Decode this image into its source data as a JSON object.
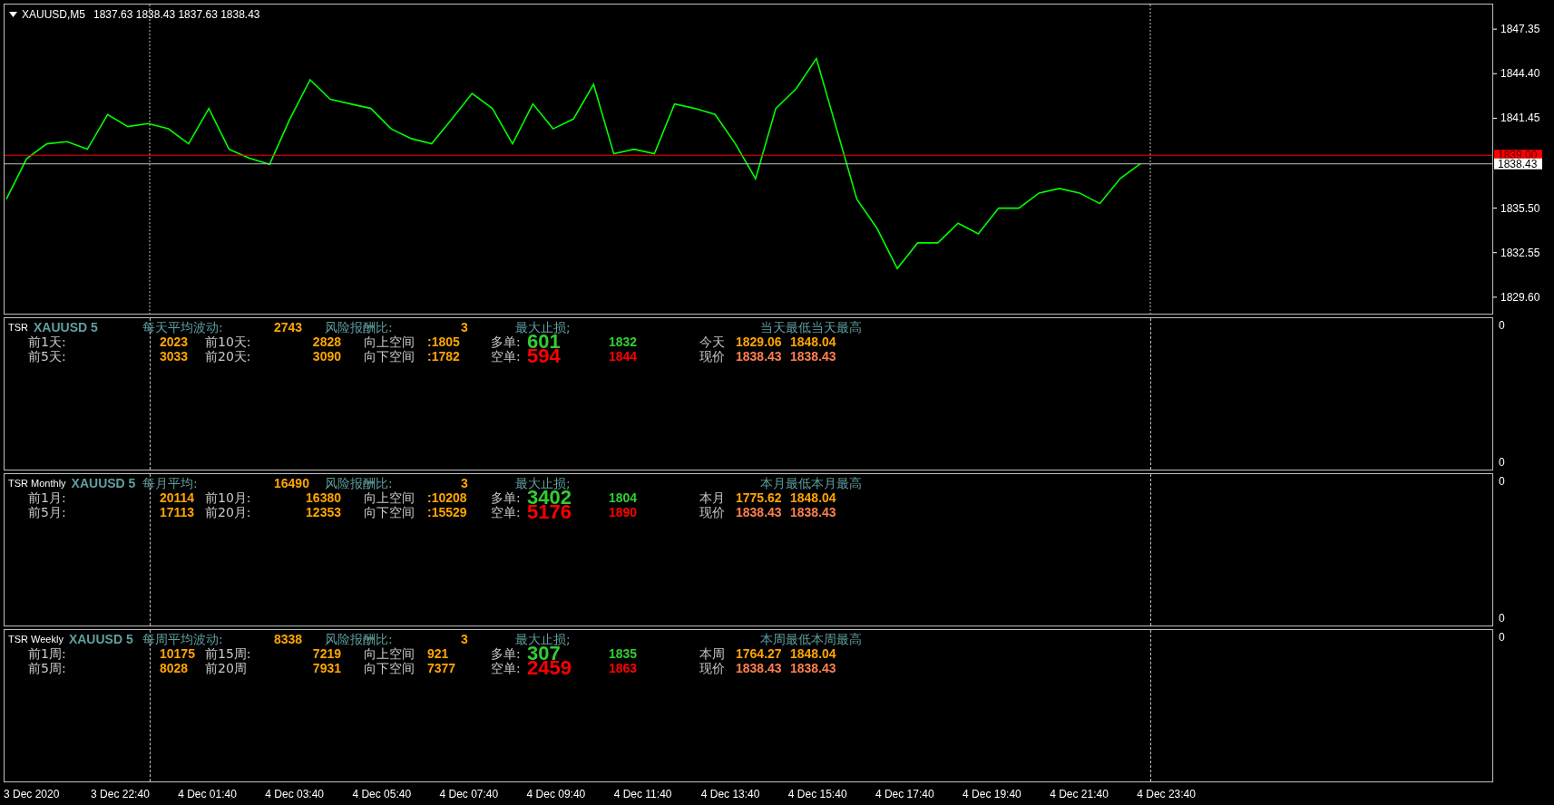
{
  "chart": {
    "symbol": "XAUUSD,M5",
    "ohlc": "1837.63 1838.43 1837.63 1838.43",
    "chart_data": {
      "type": "line",
      "ylim": [
        1828.45,
        1849.04
      ],
      "yticks": [
        {
          "value": 1847.35,
          "label": "1847.35"
        },
        {
          "value": 1844.4,
          "label": "1844.40"
        },
        {
          "value": 1841.45,
          "label": "1841.45"
        },
        {
          "value": 1835.5,
          "label": "1835.50"
        },
        {
          "value": 1832.55,
          "label": "1832.55"
        },
        {
          "value": 1829.6,
          "label": "1829.60"
        }
      ],
      "series": [
        {
          "color": "#00ff00",
          "values": [
            1836.1,
            1838.77,
            1839.76,
            1839.9,
            1839.4,
            1841.7,
            1840.9,
            1841.1,
            1840.75,
            1839.76,
            1842.1,
            1839.4,
            1838.8,
            1838.4,
            1841.4,
            1844.0,
            1842.7,
            1842.4,
            1842.1,
            1840.75,
            1840.1,
            1839.76,
            1841.4,
            1843.1,
            1842.1,
            1839.76,
            1842.4,
            1840.75,
            1841.4,
            1843.7,
            1839.1,
            1839.4,
            1839.1,
            1842.4,
            1842.1,
            1841.7,
            1839.76,
            1837.45,
            1842.1,
            1843.4,
            1845.4,
            1840.75,
            1836.1,
            1834.15,
            1831.5,
            1833.2,
            1833.2,
            1834.5,
            1833.8,
            1835.5,
            1835.5,
            1836.5,
            1836.8,
            1836.5,
            1835.8,
            1837.45,
            1838.43
          ]
        }
      ],
      "ref_lines": [
        {
          "axis": "y",
          "value": 1839.0,
          "label": "1839.00",
          "color": "#ff0000"
        },
        {
          "axis": "y",
          "value": 1838.43,
          "label": "1838.43",
          "color": "#c0c0c0"
        }
      ]
    }
  },
  "panels": [
    {
      "indicator": "TSR",
      "symbol": "XAUUSD 5",
      "avg_label": "每天平均波动:",
      "avg_value": "2743",
      "rr_label": "风险报酬比:",
      "rr_value": "3",
      "sl_label": "最大止损;",
      "range_label": "当天最低当天最高",
      "scale": [
        "0",
        "0"
      ],
      "rows": [
        {
          "kind": "long",
          "period_label": "前1天:",
          "period_value": "2023",
          "period2_label": "前10天:",
          "period2_value": "2828",
          "space_label": "向上空间",
          "space_value": ":1805",
          "order_label": "多单:",
          "order_value": "601",
          "stop_value": "1832",
          "price_label": "今天",
          "low": "1829.06",
          "high": "1848.04"
        },
        {
          "kind": "short",
          "period_label": "前5天:",
          "period_value": "3033",
          "period2_label": "前20天:",
          "period2_value": "3090",
          "space_label": "向下空间",
          "space_value": ":1782",
          "order_label": "空单:",
          "order_value": "594",
          "stop_value": "1844",
          "price_label": "现价",
          "low": "1838.43",
          "high": "1838.43"
        }
      ]
    },
    {
      "indicator": "TSR Monthly",
      "symbol": "XAUUSD 5",
      "avg_label": "每月平均:",
      "avg_value": "16490",
      "rr_label": "风险报酬比:",
      "rr_value": "3",
      "sl_label": "最大止损;",
      "range_label": "本月最低本月最高",
      "scale": [
        "0",
        "0"
      ],
      "rows": [
        {
          "kind": "long",
          "period_label": "前1月:",
          "period_value": "20114",
          "period2_label": "前10月:",
          "period2_value": "16380",
          "space_label": "向上空间",
          "space_value": ":10208",
          "order_label": "多单:",
          "order_value": "3402",
          "stop_value": "1804",
          "price_label": "本月",
          "low": "1775.62",
          "high": "1848.04"
        },
        {
          "kind": "short",
          "period_label": "前5月:",
          "period_value": "17113",
          "period2_label": "前20月:",
          "period2_value": "12353",
          "space_label": "向下空间",
          "space_value": ":15529",
          "order_label": "空单:",
          "order_value": "5176",
          "stop_value": "1890",
          "price_label": "现价",
          "low": "1838.43",
          "high": "1838.43"
        }
      ]
    },
    {
      "indicator": "TSR Weekly",
      "symbol": "XAUUSD 5",
      "avg_label": "每周平均波动:",
      "avg_value": "8338",
      "rr_label": "风险报酬比:",
      "rr_value": "3",
      "sl_label": "最大止损;",
      "range_label": "本周最低本周最高",
      "scale": [
        "0"
      ],
      "rows": [
        {
          "kind": "long",
          "period_label": "前1周:",
          "period_value": "10175",
          "period2_label": "前15周:",
          "period2_value": "7219",
          "space_label": "向上空间",
          "space_value": "921",
          "order_label": "多单:",
          "order_value": "307",
          "stop_value": "1835",
          "price_label": "本周",
          "low": "1764.27",
          "high": "1848.04"
        },
        {
          "kind": "short",
          "period_label": "前5周:",
          "period_value": "8028",
          "period2_label": "前20周",
          "period2_value": "7931",
          "space_label": "向下空间",
          "space_value": "7377",
          "order_label": "空单:",
          "order_value": "2459",
          "stop_value": "1863",
          "price_label": "现价",
          "low": "1838.43",
          "high": "1838.43"
        }
      ]
    }
  ],
  "time_axis": [
    "3 Dec 2020",
    "3 Dec 22:40",
    "4 Dec 01:40",
    "4 Dec 03:40",
    "4 Dec 05:40",
    "4 Dec 07:40",
    "4 Dec 09:40",
    "4 Dec 11:40",
    "4 Dec 13:40",
    "4 Dec 15:40",
    "4 Dec 17:40",
    "4 Dec 19:40",
    "4 Dec 21:40",
    "4 Dec 23:40"
  ]
}
